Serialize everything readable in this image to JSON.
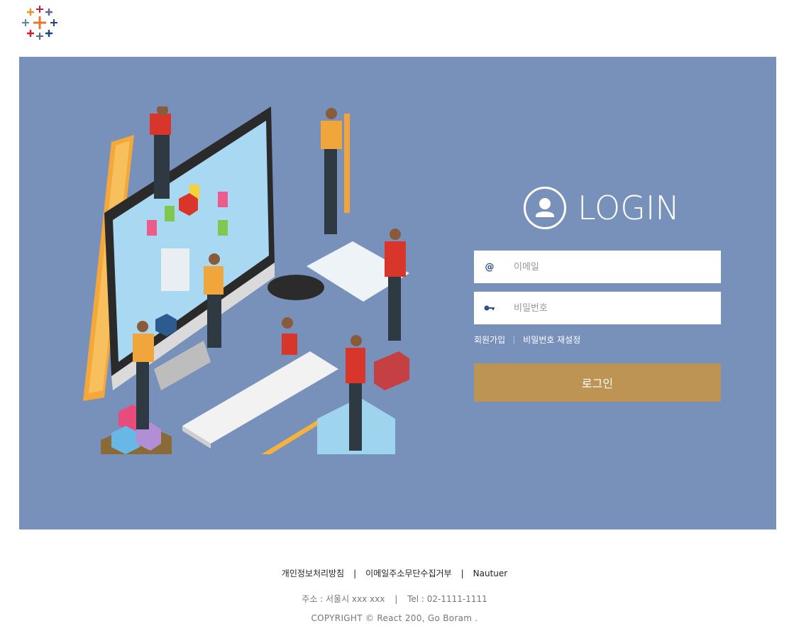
{
  "brand": {
    "logo_icon": "tableau-plus-cluster-logo"
  },
  "hero": {
    "background": "#7891bb",
    "illustration_icon": "isometric-web-design-team-illustration"
  },
  "login": {
    "title": "LOGIN",
    "user_icon": "user-circle-icon",
    "email": {
      "icon": "at-sign-icon",
      "placeholder": "이메일",
      "value": ""
    },
    "password": {
      "icon": "key-icon",
      "placeholder": "비밀번호",
      "value": ""
    },
    "signup_label": "회원가입",
    "reset_password_label": "비밀번호 재설정",
    "submit_label": "로그인",
    "button_color": "#bd9454"
  },
  "footer": {
    "links": [
      "개인정보처리방침",
      "이메일주소무단수집거부",
      "Nautuer"
    ],
    "address": "주소 : 서울시 xxx xxx",
    "tel": "Tel : 02-1111-1111",
    "copyright": "COPYRIGHT © React 200, Go Boram ."
  }
}
